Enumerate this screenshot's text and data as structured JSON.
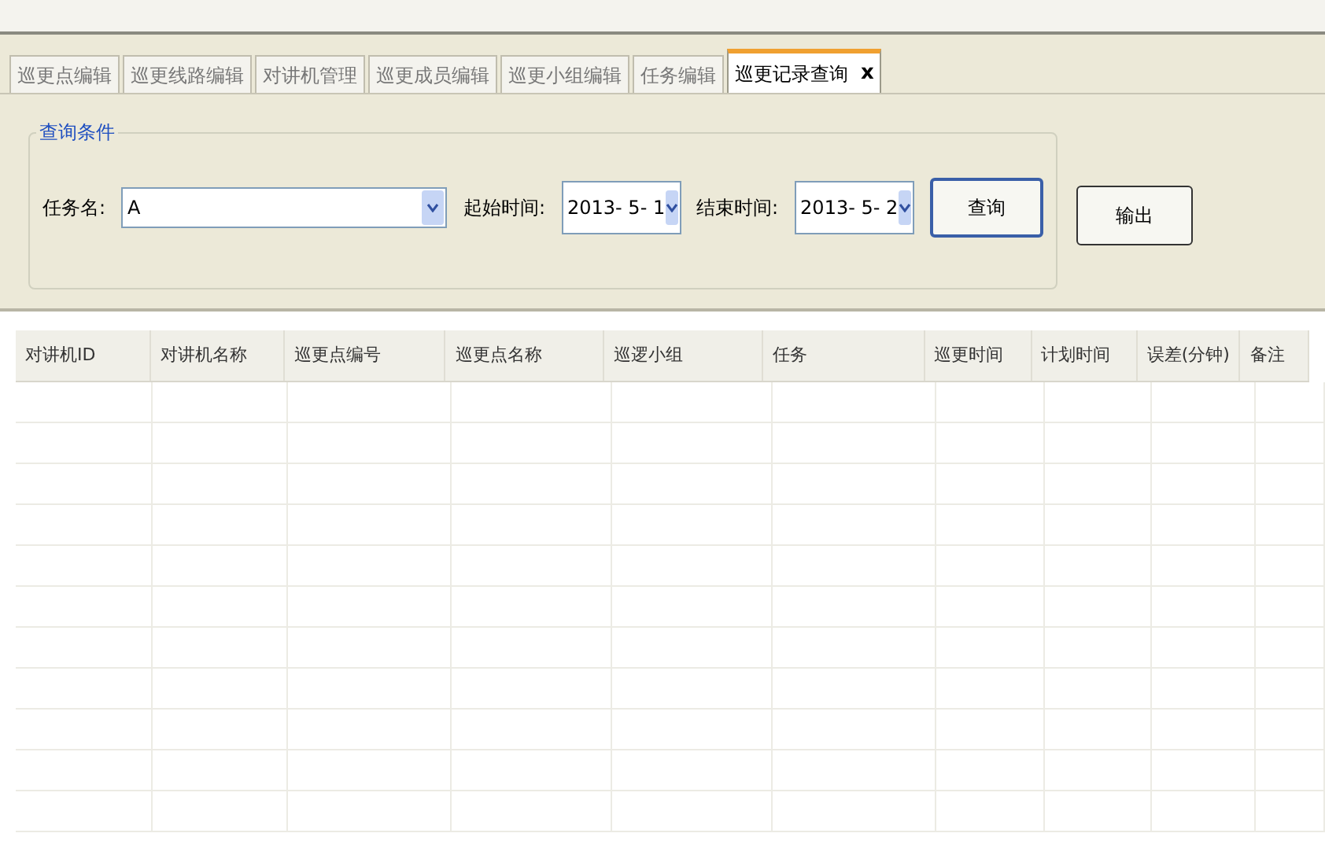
{
  "tabs": [
    {
      "label": "巡更点编辑",
      "selected": false
    },
    {
      "label": "巡更线路编辑",
      "selected": false
    },
    {
      "label": "对讲机管理",
      "selected": false
    },
    {
      "label": "巡更成员编辑",
      "selected": false
    },
    {
      "label": "巡更小组编辑",
      "selected": false
    },
    {
      "label": "任务编辑",
      "selected": false
    },
    {
      "label": "巡更记录查询",
      "selected": true,
      "close": "x"
    }
  ],
  "query_group": {
    "title": "查询条件",
    "fields": [
      {
        "label": "任务名:",
        "value": "A",
        "kind": "wide"
      },
      {
        "label": "起始时间:",
        "value": "2013- 5- 1",
        "kind": "date"
      },
      {
        "label": "结束时间:",
        "value": "2013- 5- 2",
        "kind": "date"
      }
    ],
    "buttons": [
      "查询"
    ]
  },
  "buttons": [
    "输出"
  ],
  "table": {
    "columns": [
      "对讲机ID",
      "对讲机名称",
      "巡更点编号",
      "巡更点名称",
      "巡逻小组",
      "任务",
      "巡更时间",
      "计划时间",
      "误差(分钟)",
      "备注"
    ]
  }
}
